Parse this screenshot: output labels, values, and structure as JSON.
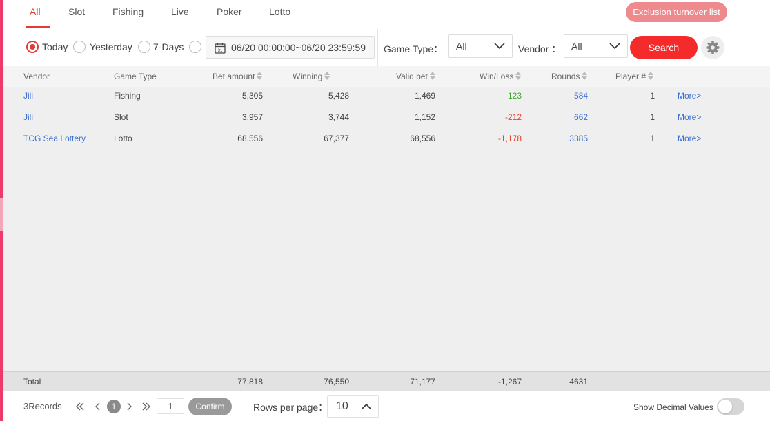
{
  "tabs": [
    "All",
    "Slot",
    "Fishing",
    "Live",
    "Poker",
    "Lotto"
  ],
  "active_tab": "All",
  "exclusion_button": "Exclusion turnover list",
  "filter": {
    "options": [
      "Today",
      "Yesterday",
      "7-Days"
    ],
    "selected": "Today",
    "date_range": "06/20 00:00:00~06/20 23:59:59",
    "game_type_label": "Game Type：",
    "game_type_value": "All",
    "vendor_label": "Vendor ：",
    "vendor_value": "All",
    "search_label": "Search"
  },
  "table": {
    "headers": [
      "Vendor",
      "Game Type",
      "Bet amount",
      "Winning",
      "Valid bet",
      "Win/Loss",
      "Rounds",
      "Player #"
    ],
    "rows": [
      {
        "vendor": "Jili",
        "game_type": "Fishing",
        "bet_amount": "5,305",
        "winning": "5,428",
        "valid_bet": "1,469",
        "win_loss": "123",
        "rounds": "584",
        "players": "1",
        "more": "More>"
      },
      {
        "vendor": "Jili",
        "game_type": "Slot",
        "bet_amount": "3,957",
        "winning": "3,744",
        "valid_bet": "1,152",
        "win_loss": "-212",
        "rounds": "662",
        "players": "1",
        "more": "More>"
      },
      {
        "vendor": "TCG Sea Lottery",
        "game_type": "Lotto",
        "bet_amount": "68,556",
        "winning": "67,377",
        "valid_bet": "68,556",
        "win_loss": "-1,178",
        "rounds": "3385",
        "players": "1",
        "more": "More>"
      }
    ],
    "total": {
      "label": "Total",
      "bet_amount": "77,818",
      "winning": "76,550",
      "valid_bet": "71,177",
      "win_loss": "-1,267",
      "rounds": "4631"
    }
  },
  "footer": {
    "records": "3Records",
    "current_page": "1",
    "page_input": "1",
    "confirm": "Confirm",
    "rows_per_page_label": "Rows per page：",
    "rows_per_page": "10",
    "decimal_label": "Show Decimal Values",
    "show_decimal": false
  },
  "colors": {
    "accent": "#e53935",
    "search": "#f52a2a",
    "exclusion": "#ee8a8e",
    "link": "#3b6fd0",
    "positive": "#3aa82a",
    "negative": "#e0452e"
  }
}
